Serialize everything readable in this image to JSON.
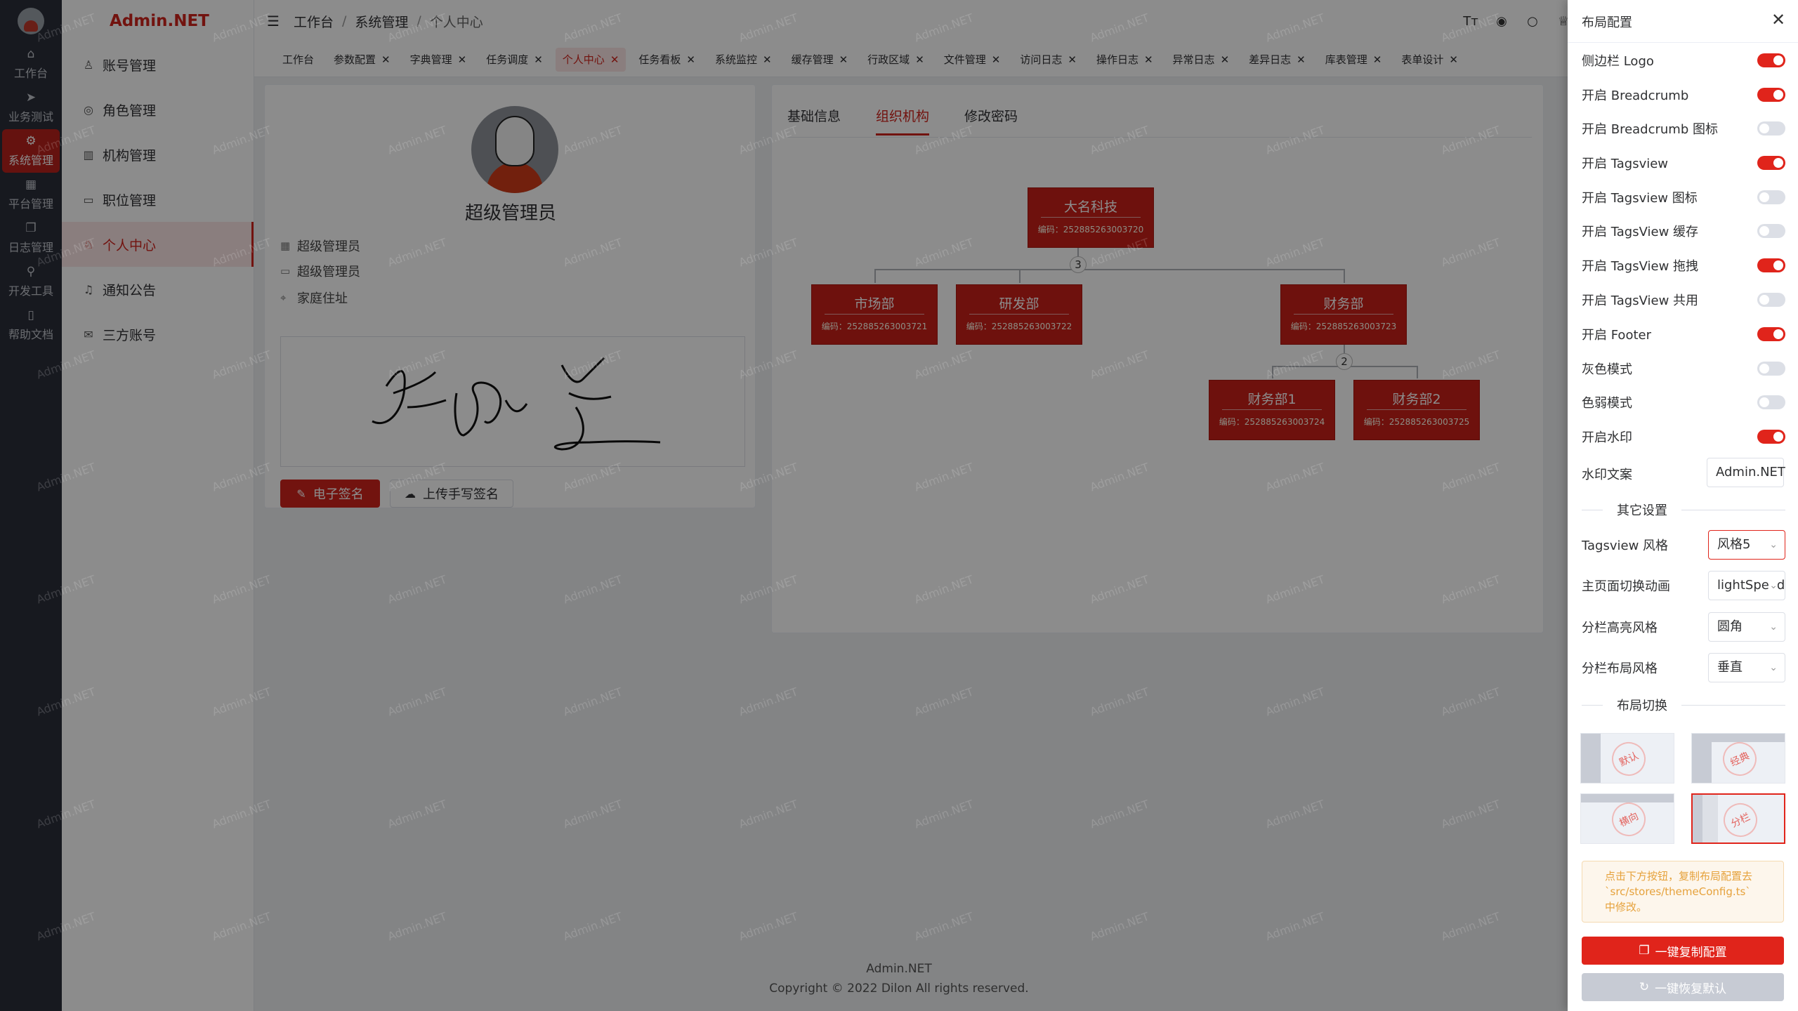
{
  "rail": {
    "items": [
      {
        "icon": "home-icon",
        "label": "工作台"
      },
      {
        "icon": "send-icon",
        "label": "业务测试"
      },
      {
        "icon": "settings-icon",
        "label": "系统管理"
      },
      {
        "icon": "grid-icon",
        "label": "平台管理"
      },
      {
        "icon": "log-icon",
        "label": "日志管理"
      },
      {
        "icon": "tool-icon",
        "label": "开发工具"
      },
      {
        "icon": "doc-icon",
        "label": "帮助文档"
      }
    ]
  },
  "brand": "Admin.NET",
  "submenu": {
    "items": [
      {
        "icon": "user-icon",
        "label": "账号管理"
      },
      {
        "icon": "role-icon",
        "label": "角色管理"
      },
      {
        "icon": "org-icon",
        "label": "机构管理"
      },
      {
        "icon": "position-icon",
        "label": "职位管理"
      },
      {
        "icon": "profile-icon",
        "label": "个人中心"
      },
      {
        "icon": "bell-icon",
        "label": "通知公告"
      },
      {
        "icon": "chat-icon",
        "label": "三方账号"
      }
    ]
  },
  "breadcrumb": [
    "工作台",
    "系统管理",
    "个人中心"
  ],
  "tags": [
    "工作台",
    "参数配置",
    "字典管理",
    "任务调度",
    "个人中心",
    "任务看板",
    "系统监控",
    "缓存管理",
    "行政区域",
    "文件管理",
    "访问日志",
    "操作日志",
    "异常日志",
    "差异日志",
    "库表管理",
    "表单设计"
  ],
  "profile": {
    "name": "超级管理员",
    "role": "超级管理员",
    "position": "超级管理员",
    "address": "家庭住址",
    "signature_text": "左所是",
    "sign_button": "电子签名",
    "upload_button": "上传手写签名"
  },
  "tabs": [
    "基础信息",
    "组织机构",
    "修改密码"
  ],
  "org": {
    "root": {
      "name": "大名科技",
      "code": "编码：252885263003720"
    },
    "root_count": "3",
    "children": [
      {
        "name": "市场部",
        "code": "编码：252885263003721"
      },
      {
        "name": "研发部",
        "code": "编码：252885263003722"
      },
      {
        "name": "财务部",
        "code": "编码：252885263003723"
      }
    ],
    "finance_count": "2",
    "grandchildren": [
      {
        "name": "财务部1",
        "code": "编码：252885263003724"
      },
      {
        "name": "财务部2",
        "code": "编码：252885263003725"
      }
    ]
  },
  "footer": {
    "line1": "Admin.NET",
    "line2": "Copyright © 2022 Dilon All rights reserved."
  },
  "watermark": "Admin.NET",
  "drawer": {
    "title": "布局配置",
    "switches": [
      {
        "label": "侧边栏 Logo",
        "on": true
      },
      {
        "label": "开启 Breadcrumb",
        "on": true
      },
      {
        "label": "开启 Breadcrumb 图标",
        "on": false
      },
      {
        "label": "开启 Tagsview",
        "on": true
      },
      {
        "label": "开启 Tagsview 图标",
        "on": false
      },
      {
        "label": "开启 TagsView 缓存",
        "on": false
      },
      {
        "label": "开启 TagsView 拖拽",
        "on": true
      },
      {
        "label": "开启 TagsView 共用",
        "on": false
      },
      {
        "label": "开启 Footer",
        "on": true
      },
      {
        "label": "灰色模式",
        "on": false
      },
      {
        "label": "色弱模式",
        "on": false
      },
      {
        "label": "开启水印",
        "on": true
      }
    ],
    "watermark_label": "水印文案",
    "watermark_value": "Admin.NET",
    "other_settings": "其它设置",
    "selects": [
      {
        "label": "Tagsview 风格",
        "value": "风格5"
      },
      {
        "label": "主页面切换动画",
        "value": "lightSpeed"
      },
      {
        "label": "分栏高亮风格",
        "value": "圆角"
      },
      {
        "label": "分栏布局风格",
        "value": "垂直"
      }
    ],
    "layout_switch": "布局切换",
    "layouts": [
      "默认",
      "经典",
      "横向",
      "分栏"
    ],
    "tip": "点击下方按钮，复制布局配置去 `src/stores/themeConfig.ts` 中修改。",
    "copy_button": "一键复制配置",
    "reset_button": "一键恢复默认"
  },
  "colors": {
    "accent": "#d0231c",
    "sidebar": "#2b2f3a"
  }
}
